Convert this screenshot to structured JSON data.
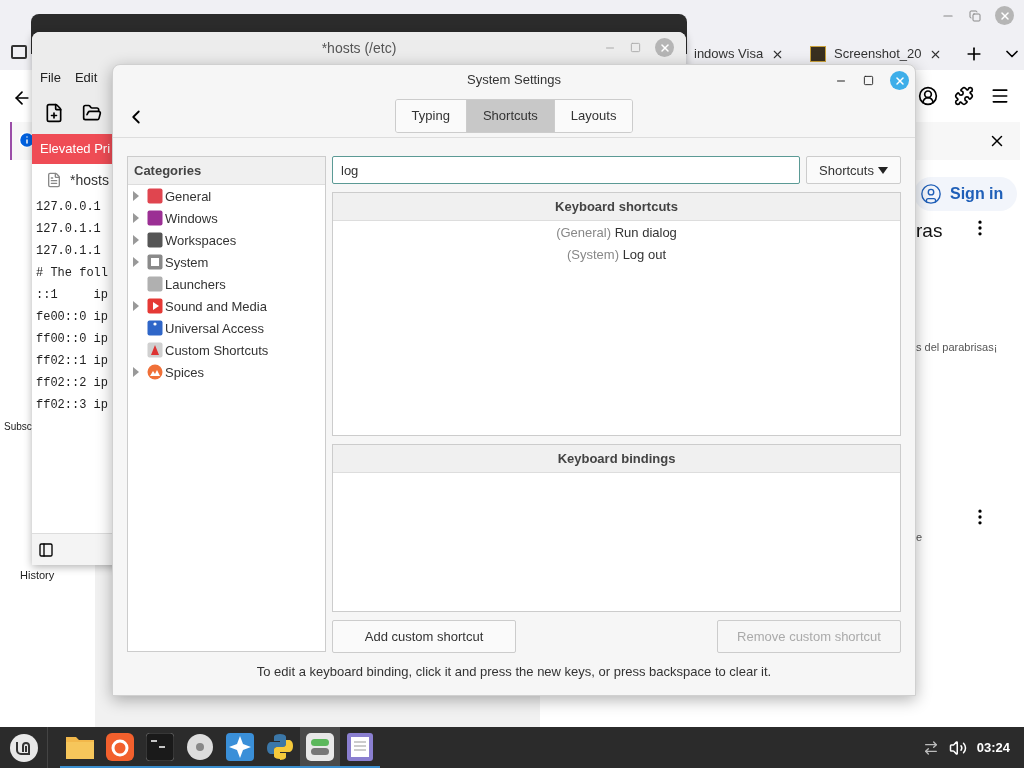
{
  "browser": {
    "tabs": [
      {
        "title": "indows Visa"
      },
      {
        "title": "Screenshot_20"
      }
    ],
    "sidebar": [
      "Subsc",
      "History"
    ],
    "sign_in": "Sign in",
    "heading": "ras",
    "snippet": "s del parabrisas¡",
    "snippet_2": "e"
  },
  "editor": {
    "title": "*hosts (/etc)",
    "menu": [
      "File",
      "Edit"
    ],
    "banner": "Elevated Pri",
    "tab": "*hosts",
    "lines": [
      "127.0.0.1",
      "127.0.1.1",
      "127.0.1.1",
      "# The foll",
      "::1     ip",
      "fe00::0 ip",
      "ff00::0 ip",
      "ff02::1 ip",
      "ff02::2 ip",
      "ff02::3 ip"
    ]
  },
  "settings": {
    "title": "System Settings",
    "tabs": [
      {
        "label": "Typing",
        "selected": false
      },
      {
        "label": "Shortcuts",
        "selected": true
      },
      {
        "label": "Layouts",
        "selected": false
      }
    ],
    "categories_header": "Categories",
    "categories": [
      {
        "label": "General",
        "expandable": true
      },
      {
        "label": "Windows",
        "expandable": true
      },
      {
        "label": "Workspaces",
        "expandable": true
      },
      {
        "label": "System",
        "expandable": true
      },
      {
        "label": "Launchers",
        "expandable": false
      },
      {
        "label": "Sound and Media",
        "expandable": true
      },
      {
        "label": "Universal Access",
        "expandable": false
      },
      {
        "label": "Custom Shortcuts",
        "expandable": false
      },
      {
        "label": "Spices",
        "expandable": true
      }
    ],
    "search": {
      "value": "log"
    },
    "filter": "Shortcuts",
    "shortcuts_header": "Keyboard shortcuts",
    "shortcuts": [
      {
        "category": "(General)",
        "name": "Run dialog"
      },
      {
        "category": "(System)",
        "name": "Log out"
      }
    ],
    "bindings_header": "Keyboard bindings",
    "buttons": [
      {
        "label": "Add custom shortcut",
        "disabled": false
      },
      {
        "label": "Remove custom shortcut",
        "disabled": true
      }
    ],
    "hint": "To edit a keyboard binding, click it and press the new keys, or press backspace to clear it."
  },
  "taskbar": {
    "apps": [
      {
        "selected": false
      },
      {
        "selected": false
      },
      {
        "selected": false
      },
      {
        "selected": false
      },
      {
        "selected": false
      },
      {
        "selected": false
      },
      {
        "selected": true
      },
      {
        "selected": false
      }
    ],
    "clock": "03:24"
  }
}
